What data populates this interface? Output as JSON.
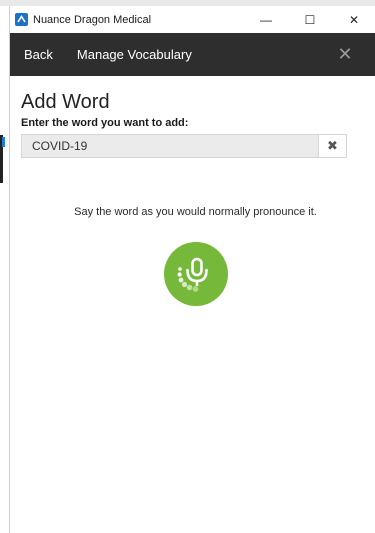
{
  "window": {
    "title": "Nuance Dragon Medical",
    "controls": {
      "minimize": "—",
      "maximize": "☐",
      "close": "✕"
    }
  },
  "nav": {
    "back_label": "Back",
    "section_label": "Manage Vocabulary",
    "close_glyph": "✕"
  },
  "page": {
    "title": "Add Word",
    "field_label": "Enter the word you want to add:",
    "word_value": "COVID-19",
    "clear_glyph": "✖",
    "instruction": "Say the word as you would normally pronounce it."
  },
  "colors": {
    "nav_bg": "#2e2e2e",
    "mic_green": "#76b83a",
    "app_logo_blue": "#1b73c9"
  },
  "icons": [
    "app-logo-icon",
    "close-icon",
    "clear-icon",
    "microphone-icon"
  ]
}
